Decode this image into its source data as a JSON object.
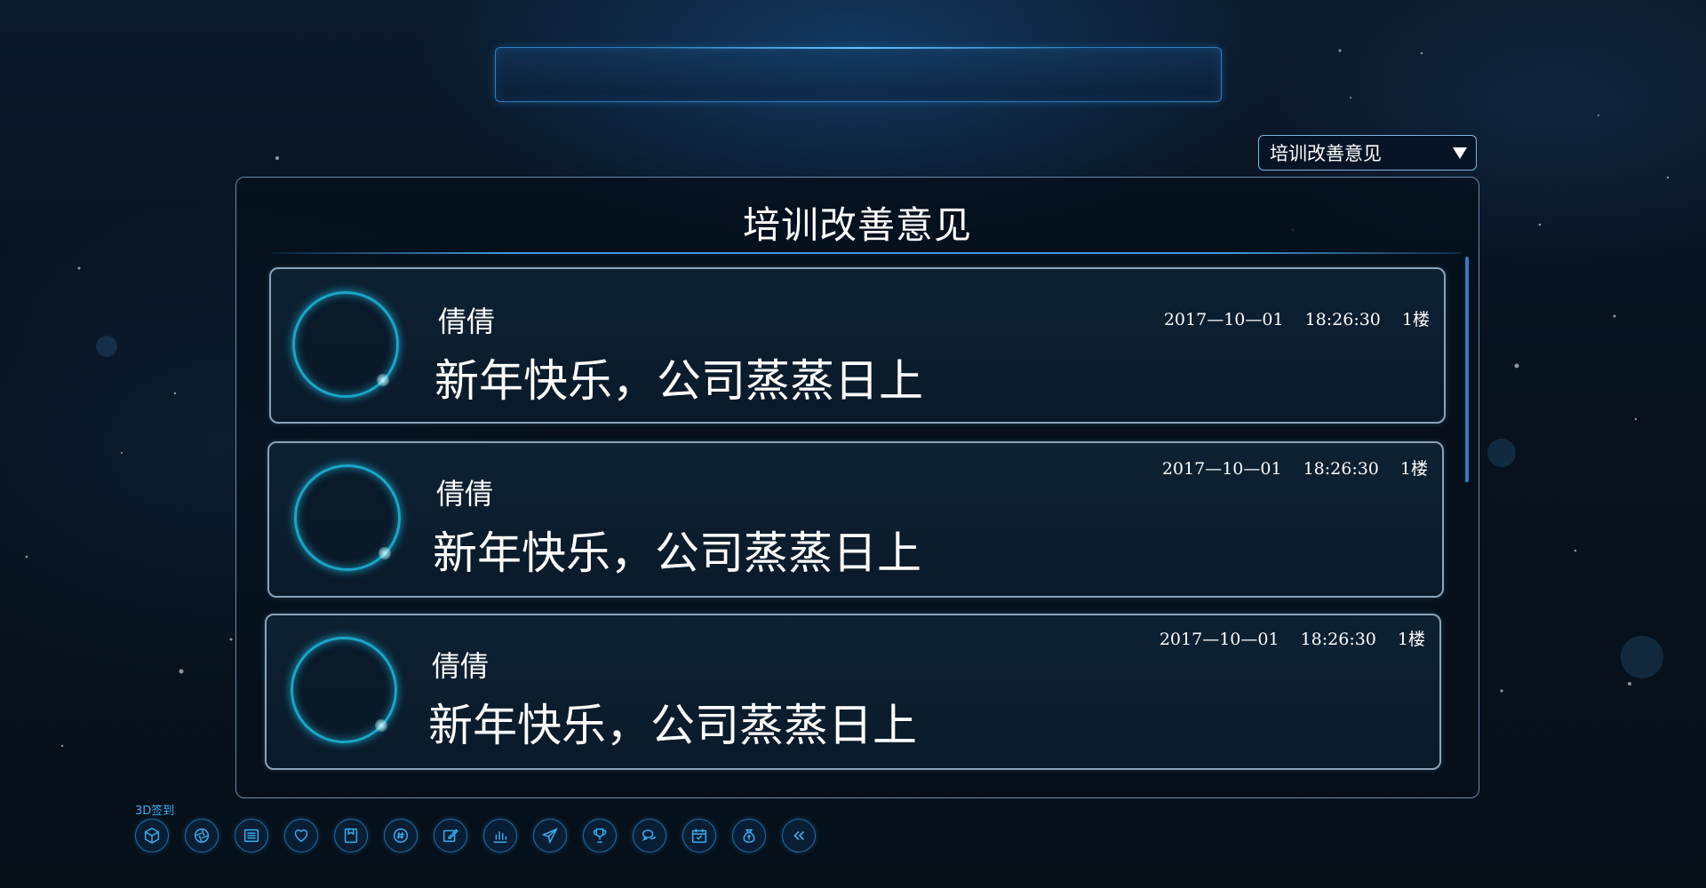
{
  "dropdown": {
    "selected": "培训改善意见"
  },
  "panel": {
    "title": "培训改善意见"
  },
  "posts": [
    {
      "author": "倩倩",
      "message": "新年快乐，公司蒸蒸日上",
      "date": "2017—10—01",
      "time": "18:26:30",
      "floor": "1楼"
    },
    {
      "author": "倩倩",
      "message": "新年快乐，公司蒸蒸日上",
      "date": "2017—10—01",
      "time": "18:26:30",
      "floor": "1楼"
    },
    {
      "author": "倩倩",
      "message": "新年快乐，公司蒸蒸日上",
      "date": "2017—10—01",
      "time": "18:26:30",
      "floor": "1楼"
    }
  ],
  "toolbar": {
    "label": "3D签到",
    "icons": [
      "cube-icon",
      "aperture-icon",
      "list-icon",
      "heart-icon",
      "bookmark-box-icon",
      "hashtag-chat-icon",
      "edit-icon",
      "bar-chart-icon",
      "send-icon",
      "trophy-icon",
      "chat-bubbles-icon",
      "calendar-icon",
      "money-bag-icon",
      "double-chevron-left-icon"
    ]
  },
  "colors": {
    "accent": "#2f7fc0",
    "ring": "#19a6c8",
    "toolbar_text": "#3aaef0",
    "card_border": "#8aa3b8"
  }
}
